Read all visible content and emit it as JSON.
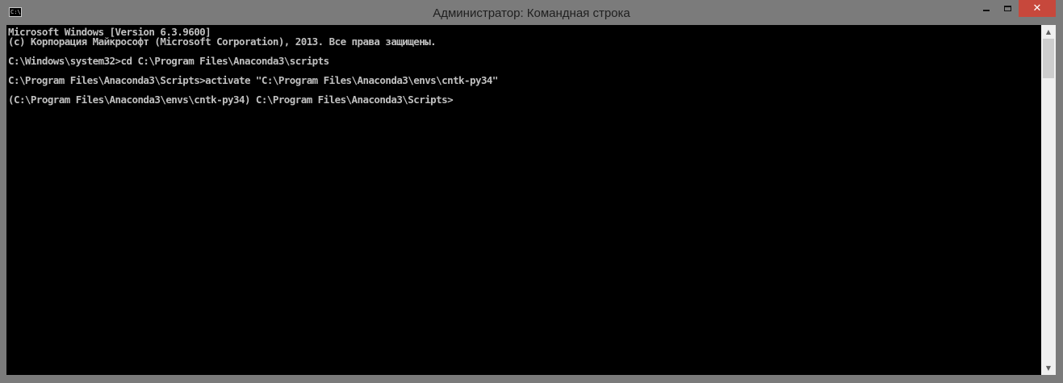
{
  "window": {
    "title": "Администратор: Командная строка",
    "icon": "cmd-icon",
    "icon_text": "C:\\",
    "controls": {
      "minimize_icon": "minimize-icon",
      "maximize_icon": "maximize-icon",
      "close_icon": "close-icon",
      "close_label": "✕"
    }
  },
  "console": {
    "lines": [
      "Microsoft Windows [Version 6.3.9600]",
      "(c) Корпорация Майкрософт (Microsoft Corporation), 2013. Все права защищены.",
      "",
      "C:\\Windows\\system32>cd C:\\Program Files\\Anaconda3\\scripts",
      "",
      "C:\\Program Files\\Anaconda3\\Scripts>activate \"C:\\Program Files\\Anaconda3\\envs\\cntk-py34\"",
      "",
      "(C:\\Program Files\\Anaconda3\\envs\\cntk-py34) C:\\Program Files\\Anaconda3\\Scripts>"
    ]
  },
  "scrollbar": {
    "up_arrow": "▲",
    "down_arrow": "▼"
  },
  "colors": {
    "frame": "#7b7b7b",
    "console_background": "#000000",
    "console_text": "#c0c0c0",
    "close_button": "#c7483c"
  }
}
